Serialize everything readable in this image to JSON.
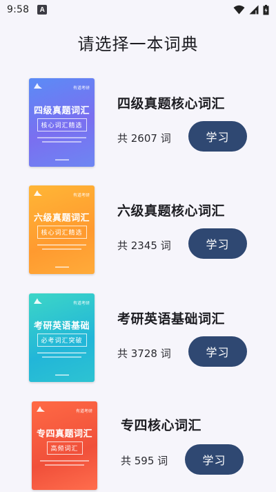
{
  "status_bar": {
    "time": "9:58",
    "notif_letter": "A"
  },
  "page": {
    "title": "请选择一本词典"
  },
  "books": [
    {
      "name": "四级真题核心词汇",
      "count_label": "共 2607 词",
      "button_label": "学习",
      "cover": {
        "brand": "有道考研",
        "title": "四级真题词汇",
        "subtitle": "核心词汇精选",
        "theme": "#6a7ff2"
      }
    },
    {
      "name": "六级真题核心词汇",
      "count_label": "共 2345 词",
      "button_label": "学习",
      "cover": {
        "brand": "有道考研",
        "title": "六级真题词汇",
        "subtitle": "核心词汇精选",
        "theme": "#ffa534"
      }
    },
    {
      "name": "考研英语基础词汇",
      "count_label": "共 3728 词",
      "button_label": "学习",
      "cover": {
        "brand": "有道考研",
        "title": "考研英语基础",
        "subtitle": "必考词汇突破",
        "theme": "#2ec4d4"
      }
    },
    {
      "name": "专四核心词汇",
      "count_label": "共 595 词",
      "button_label": "学习",
      "cover": {
        "brand": "有道考研",
        "title": "专四真题词汇",
        "subtitle": "高频词汇",
        "theme": "#f45a3f"
      }
    }
  ],
  "colors": {
    "background": "#f6f5fb",
    "button": "#2f4872",
    "button_text": "#ffffff"
  }
}
